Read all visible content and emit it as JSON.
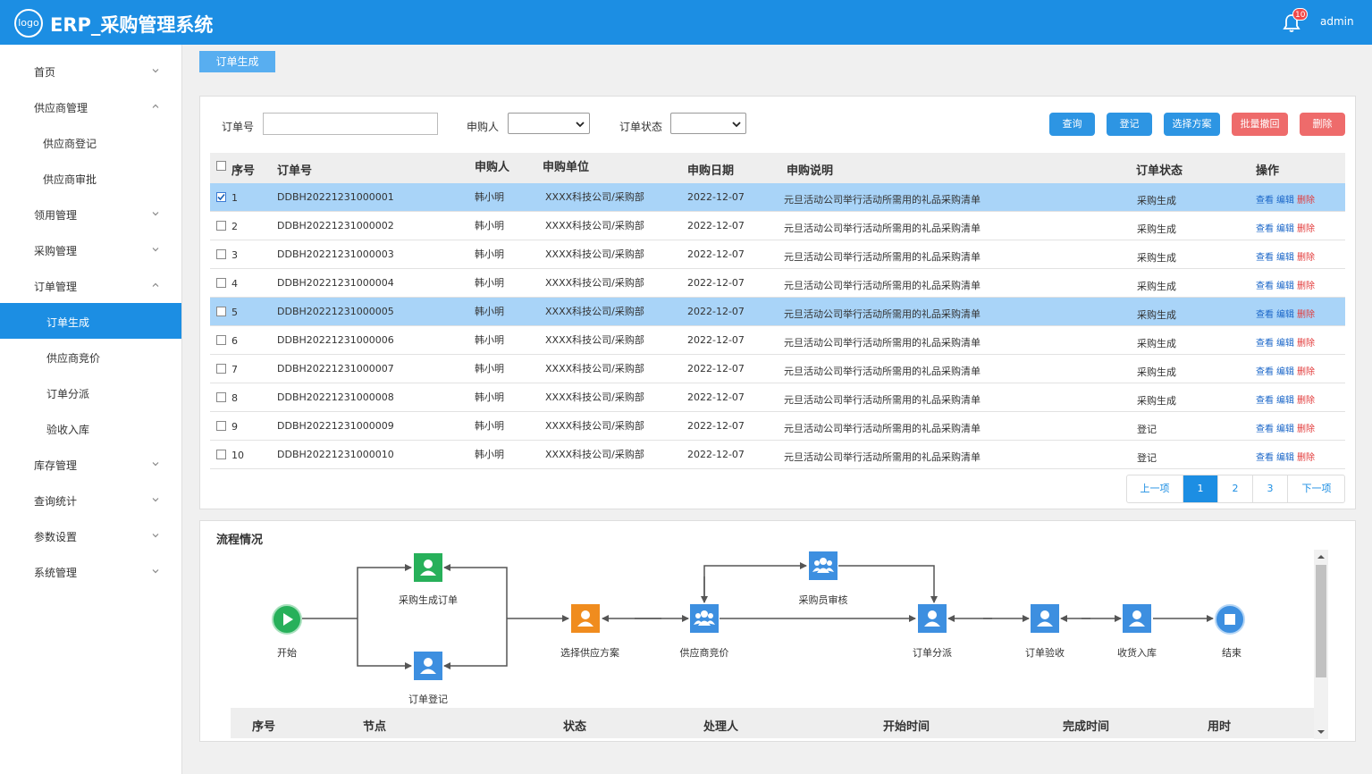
{
  "header": {
    "logo_text": "logo",
    "app_title": "ERP_采购管理系统",
    "notification_count": "10",
    "user_name": "admin"
  },
  "sidebar": {
    "items": [
      {
        "label": "首页",
        "chevron": "down"
      },
      {
        "label": "供应商管理",
        "chevron": "up"
      },
      {
        "label": "供应商登记",
        "chevron": ""
      },
      {
        "label": "供应商审批",
        "chevron": ""
      },
      {
        "label": "领用管理",
        "chevron": "down"
      },
      {
        "label": "采购管理",
        "chevron": "down"
      },
      {
        "label": "订单管理",
        "chevron": "up"
      },
      {
        "label": "订单生成",
        "chevron": "",
        "active": true
      },
      {
        "label": "供应商竞价",
        "chevron": ""
      },
      {
        "label": "订单分派",
        "chevron": ""
      },
      {
        "label": "验收入库",
        "chevron": ""
      },
      {
        "label": "库存管理",
        "chevron": "down"
      },
      {
        "label": "查询统计",
        "chevron": "down"
      },
      {
        "label": "参数设置",
        "chevron": "down"
      },
      {
        "label": "系统管理",
        "chevron": "down"
      }
    ]
  },
  "tab": {
    "label": "订单生成"
  },
  "filters": {
    "order_no_label": "订单号",
    "order_no_value": "",
    "requester_label": "申购人",
    "requester_value": "",
    "status_label": "订单状态",
    "status_value": ""
  },
  "buttons": {
    "query": "查询",
    "register": "登记",
    "select_plan": "选择方案",
    "batch_revoke": "批量撤回",
    "delete": "删除"
  },
  "table": {
    "headers": [
      "序号",
      "订单号",
      "申购人",
      "申购单位",
      "申购日期",
      "申购说明",
      "订单状态",
      "操作"
    ],
    "ops": {
      "view": "查看",
      "edit": "编辑",
      "del": "删除"
    },
    "rows": [
      {
        "no": "1",
        "order": "DDBH20221231000001",
        "person": "韩小明",
        "unit": "XXXX科技公司/采购部",
        "date": "2022-12-07",
        "desc": "元旦活动公司举行活动所需用的礼品采购清单",
        "status": "采购生成",
        "checked": true,
        "highlight": true
      },
      {
        "no": "2",
        "order": "DDBH20221231000002",
        "person": "韩小明",
        "unit": "XXXX科技公司/采购部",
        "date": "2022-12-07",
        "desc": "元旦活动公司举行活动所需用的礼品采购清单",
        "status": "采购生成",
        "checked": false,
        "highlight": false
      },
      {
        "no": "3",
        "order": "DDBH20221231000003",
        "person": "韩小明",
        "unit": "XXXX科技公司/采购部",
        "date": "2022-12-07",
        "desc": "元旦活动公司举行活动所需用的礼品采购清单",
        "status": "采购生成",
        "checked": false,
        "highlight": false
      },
      {
        "no": "4",
        "order": "DDBH20221231000004",
        "person": "韩小明",
        "unit": "XXXX科技公司/采购部",
        "date": "2022-12-07",
        "desc": "元旦活动公司举行活动所需用的礼品采购清单",
        "status": "采购生成",
        "checked": false,
        "highlight": false
      },
      {
        "no": "5",
        "order": "DDBH20221231000005",
        "person": "韩小明",
        "unit": "XXXX科技公司/采购部",
        "date": "2022-12-07",
        "desc": "元旦活动公司举行活动所需用的礼品采购清单",
        "status": "采购生成",
        "checked": false,
        "highlight": true
      },
      {
        "no": "6",
        "order": "DDBH20221231000006",
        "person": "韩小明",
        "unit": "XXXX科技公司/采购部",
        "date": "2022-12-07",
        "desc": "元旦活动公司举行活动所需用的礼品采购清单",
        "status": "采购生成",
        "checked": false,
        "highlight": false
      },
      {
        "no": "7",
        "order": "DDBH20221231000007",
        "person": "韩小明",
        "unit": "XXXX科技公司/采购部",
        "date": "2022-12-07",
        "desc": "元旦活动公司举行活动所需用的礼品采购清单",
        "status": "采购生成",
        "checked": false,
        "highlight": false
      },
      {
        "no": "8",
        "order": "DDBH20221231000008",
        "person": "韩小明",
        "unit": "XXXX科技公司/采购部",
        "date": "2022-12-07",
        "desc": "元旦活动公司举行活动所需用的礼品采购清单",
        "status": "采购生成",
        "checked": false,
        "highlight": false
      },
      {
        "no": "9",
        "order": "DDBH20221231000009",
        "person": "韩小明",
        "unit": "XXXX科技公司/采购部",
        "date": "2022-12-07",
        "desc": "元旦活动公司举行活动所需用的礼品采购清单",
        "status": "登记",
        "checked": false,
        "highlight": false
      },
      {
        "no": "10",
        "order": "DDBH20221231000010",
        "person": "韩小明",
        "unit": "XXXX科技公司/采购部",
        "date": "2022-12-07",
        "desc": "元旦活动公司举行活动所需用的礼品采购清单",
        "status": "登记",
        "checked": false,
        "highlight": false
      }
    ]
  },
  "pagination": {
    "prev": "上一项",
    "pages": [
      "1",
      "2",
      "3"
    ],
    "current": "1",
    "next": "下一项"
  },
  "flow": {
    "title": "流程情况",
    "nodes": {
      "start": "开始",
      "purchase_gen": "采购生成订单",
      "order_register": "订单登记",
      "select_supplier": "选择供应方案",
      "supplier_bid": "供应商竞价",
      "buyer_review": "采购员审核",
      "order_dispatch": "订单分派",
      "order_accept": "订单验收",
      "receive_stock": "收货入库",
      "end": "结束"
    },
    "table_headers": [
      "序号",
      "节点",
      "状态",
      "处理人",
      "开始时间",
      "完成时间",
      "用时"
    ],
    "colors": {
      "green": "#27b05a",
      "blue": "#3d8fe0",
      "orange": "#f08c1e"
    }
  }
}
